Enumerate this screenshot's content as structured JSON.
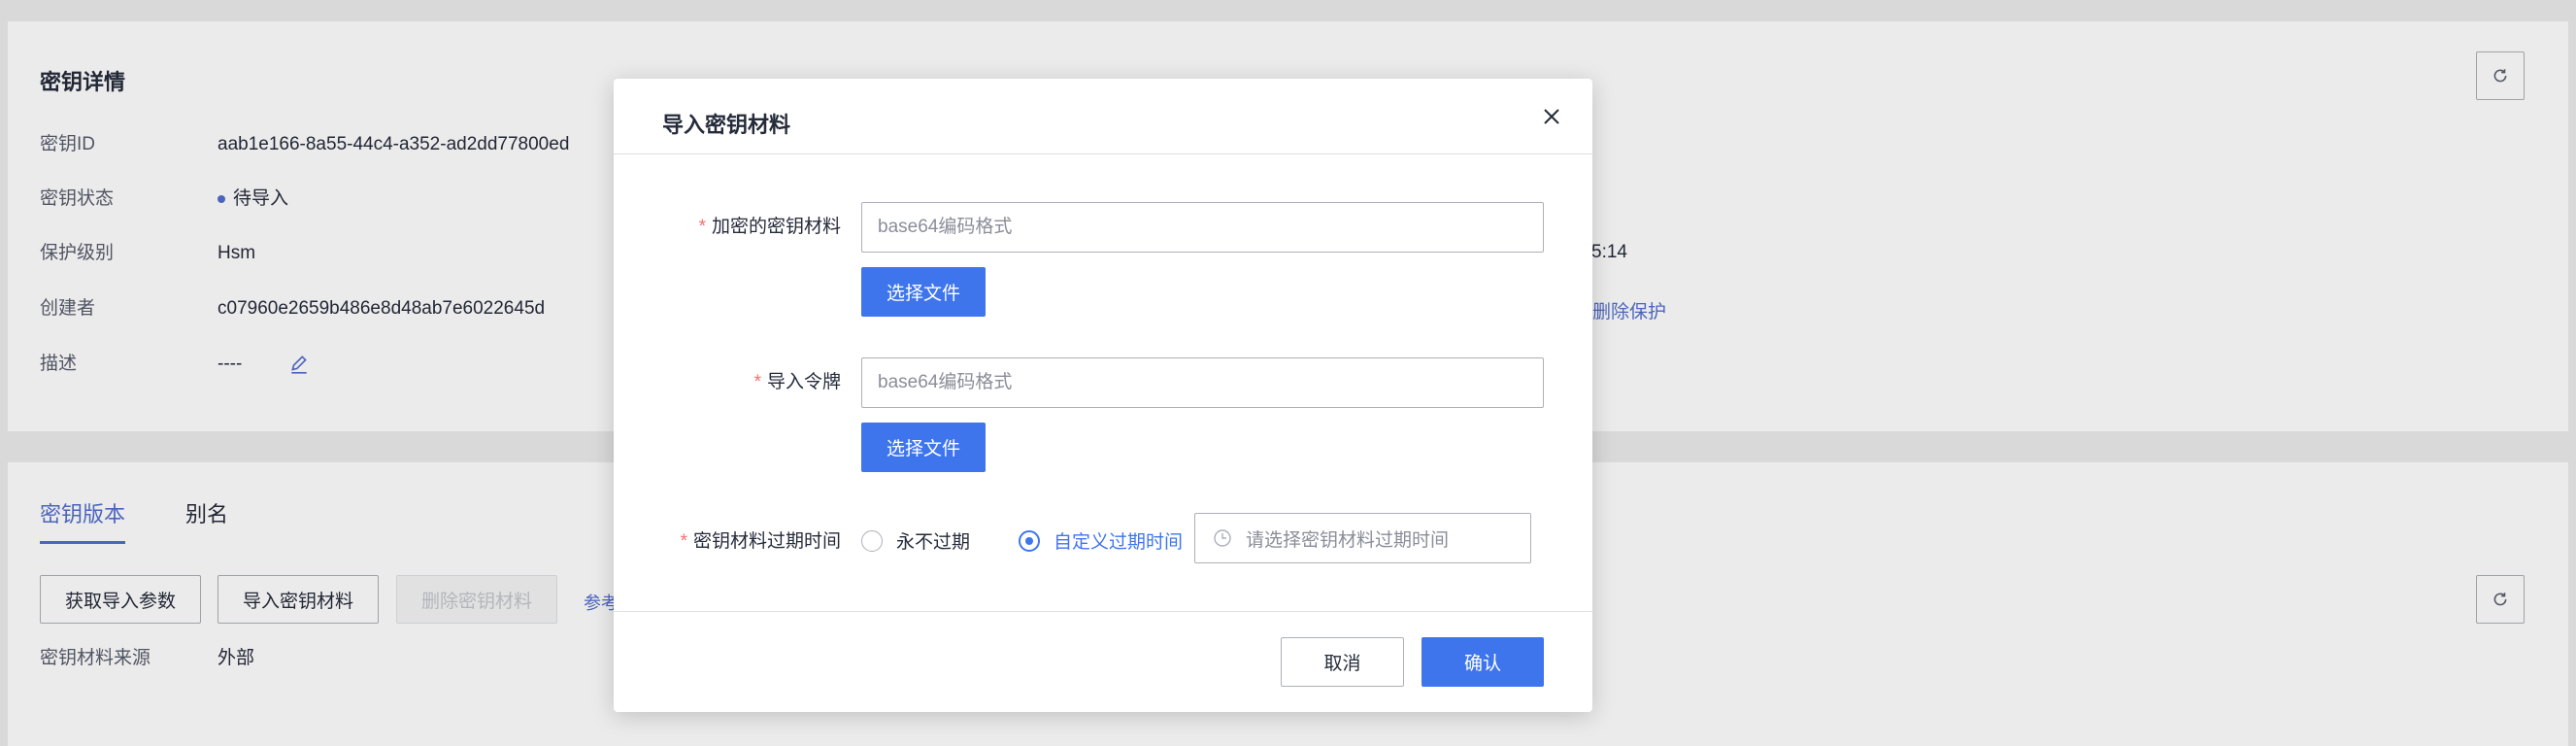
{
  "details": {
    "title": "密钥详情",
    "rows": [
      {
        "label": "密钥ID",
        "value": "aab1e166-8a55-44c4-a352-ad2dd77800ed"
      },
      {
        "label": "密钥状态",
        "value": "待导入"
      },
      {
        "label": "保护级别",
        "value": "Hsm"
      },
      {
        "label": "创建者",
        "value": "c07960e2659b486e8d48ab7e6022645d"
      },
      {
        "label": "描述",
        "value": "----"
      }
    ],
    "right_time_fragment": "5:14",
    "right_link_fragment": "删除保护",
    "refresh_icon": "refresh-icon",
    "edit_icon": "edit-icon"
  },
  "versions": {
    "tabs": [
      {
        "label": "密钥版本",
        "active": true
      },
      {
        "label": "别名",
        "active": false
      }
    ],
    "buttons": {
      "get_import_params": "获取导入参数",
      "import_material": "导入密钥材料",
      "delete_material": "删除密钥材料"
    },
    "ref_link_fragment": "参考",
    "source_label": "密钥材料来源",
    "source_value": "外部"
  },
  "modal": {
    "title": "导入密钥材料",
    "close_icon": "close-icon",
    "fields": {
      "material": {
        "required_mark": "*",
        "label": "加密的密钥材料",
        "placeholder": "base64编码格式",
        "value": "",
        "file_button": "选择文件"
      },
      "token": {
        "required_mark": "*",
        "label": "导入令牌",
        "placeholder": "base64编码格式",
        "value": "",
        "file_button": "选择文件"
      },
      "expiry": {
        "required_mark": "*",
        "label": "密钥材料过期时间",
        "options": [
          {
            "label": "永不过期",
            "checked": false
          },
          {
            "label": "自定义过期时间",
            "checked": true
          }
        ],
        "date_placeholder": "请选择密钥材料过期时间",
        "clock_icon": "clock-icon"
      }
    },
    "footer": {
      "cancel": "取消",
      "confirm": "确认"
    }
  },
  "colors": {
    "primary": "#3e75ed",
    "link": "#526ecc",
    "required": "#f66f6a",
    "text": "#252b3a"
  }
}
